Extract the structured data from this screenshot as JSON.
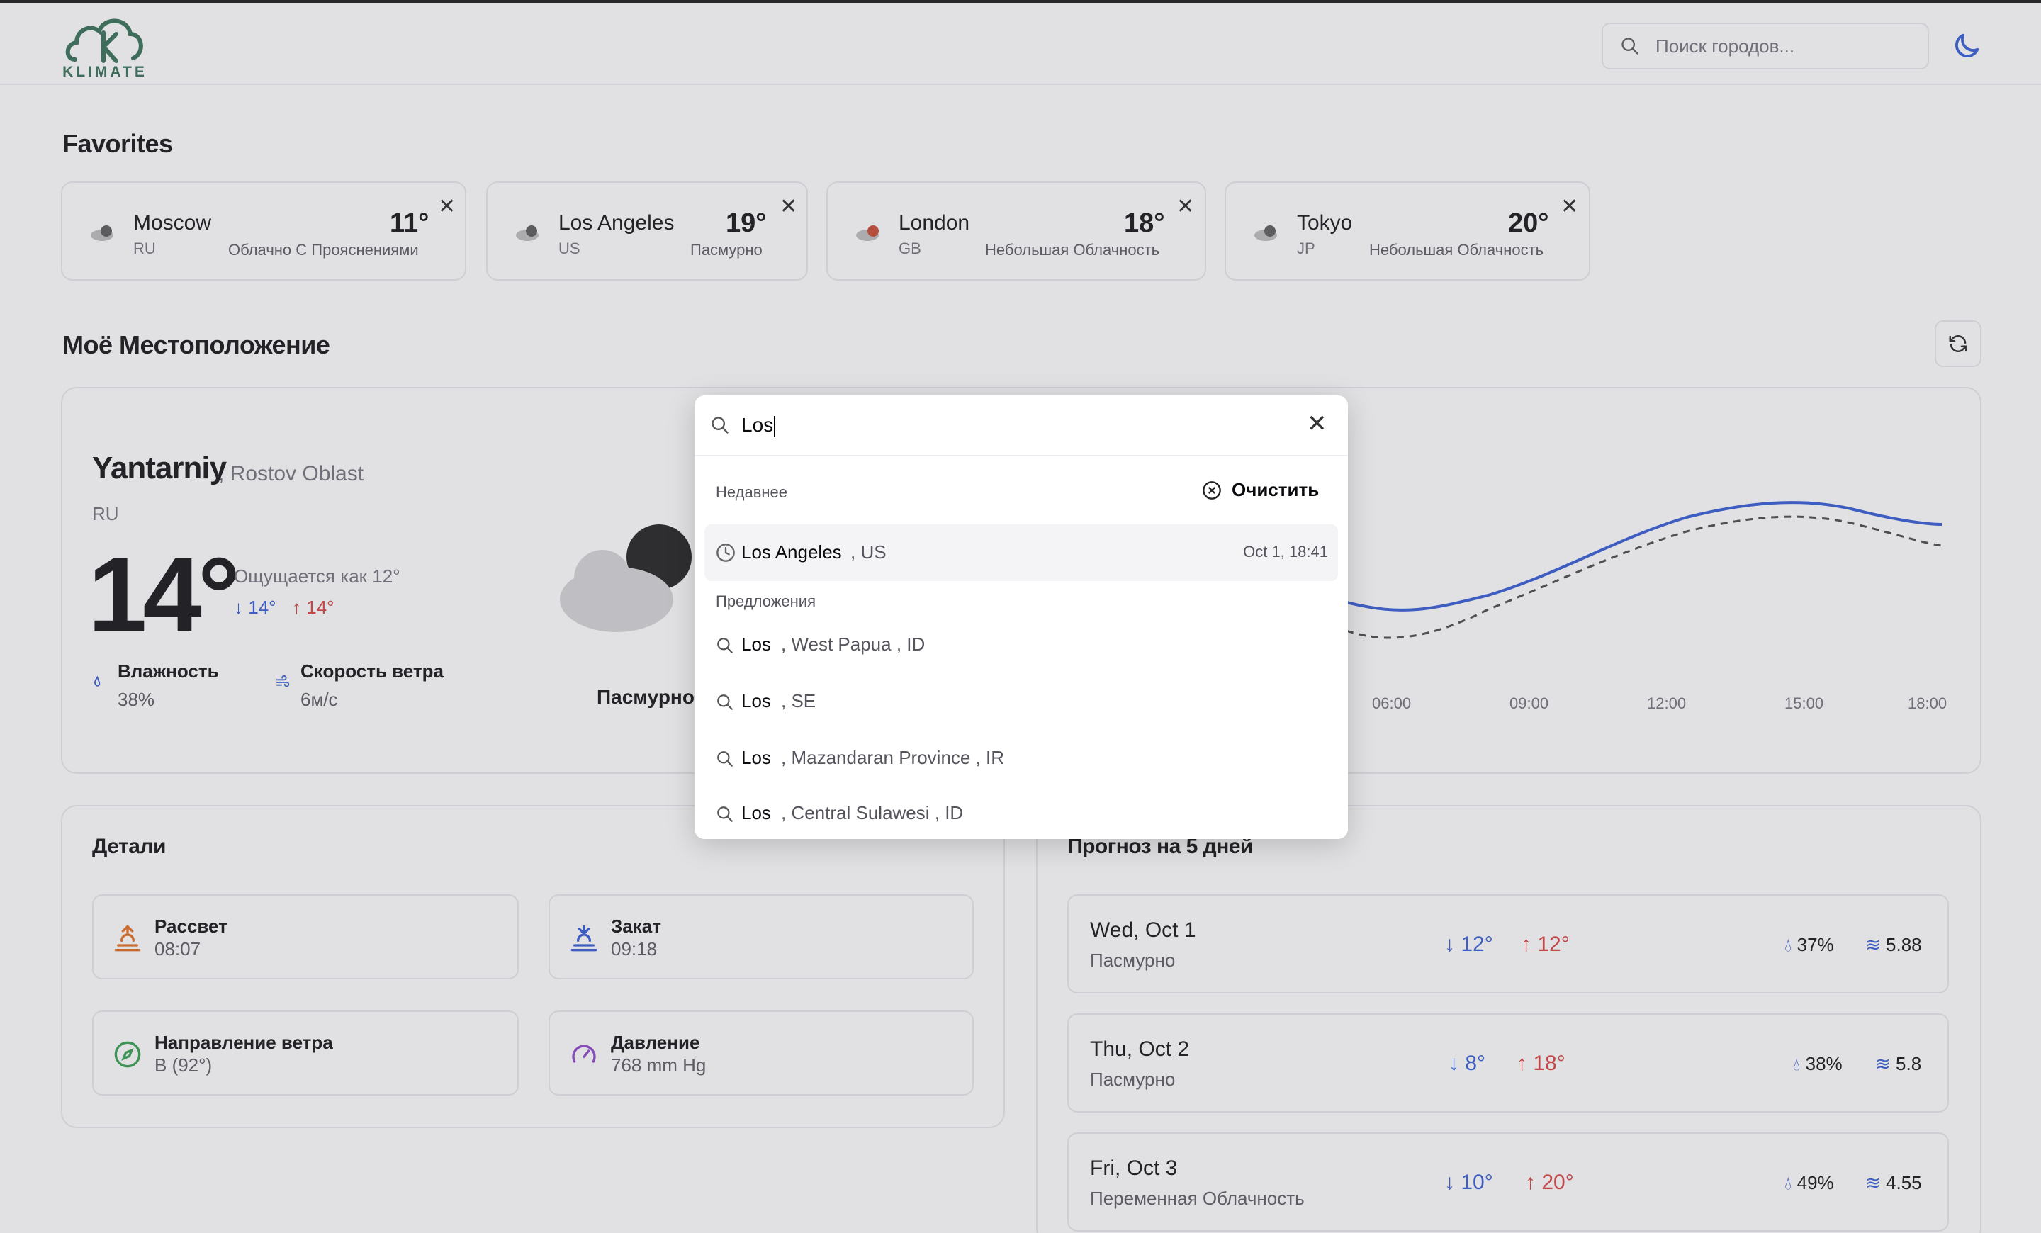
{
  "header": {
    "logo_text": "KLIMATE",
    "search_placeholder": "Поиск городов..."
  },
  "favorites": {
    "title": "Favorites",
    "items": [
      {
        "city": "Moscow",
        "country": "RU",
        "temp": "11°",
        "desc": "Облачно С Прояснениями"
      },
      {
        "city": "Los Angeles",
        "country": "US",
        "temp": "19°",
        "desc": "Пасмурно"
      },
      {
        "city": "London",
        "country": "GB",
        "temp": "18°",
        "desc": "Небольшая Облачность"
      },
      {
        "city": "Tokyo",
        "country": "JP",
        "temp": "20°",
        "desc": "Небольшая Облачность"
      }
    ]
  },
  "location": {
    "title": "Моё Местоположение",
    "city": "Yantarniy",
    "region": ", Rostov Oblast",
    "country": "RU",
    "temp": "14°",
    "feels_like": "Ощущается как 12°",
    "min": "14°",
    "max": "14°",
    "humidity_label": "Влажность",
    "humidity_value": "38%",
    "wind_label": "Скорость ветра",
    "wind_value": "6м/с",
    "condition": "Пасмурно",
    "hours": [
      "06:00",
      "09:00",
      "12:00",
      "15:00",
      "18:00"
    ]
  },
  "details": {
    "title": "Детали",
    "sunrise_label": "Рассвет",
    "sunrise_value": "08:07",
    "sunset_label": "Закат",
    "sunset_value": "09:18",
    "wind_dir_label": "Направление ветра",
    "wind_dir_value": "В (92°)",
    "pressure_label": "Давление",
    "pressure_value": "768 mm Hg"
  },
  "forecast": {
    "title": "Прогноз на 5 дней",
    "days": [
      {
        "day": "Wed, Oct 1",
        "desc": "Пасмурно",
        "min": "12°",
        "max": "12°",
        "humidity": "37%",
        "wind": "5.88"
      },
      {
        "day": "Thu, Oct 2",
        "desc": "Пасмурно",
        "min": "8°",
        "max": "18°",
        "humidity": "38%",
        "wind": "5.8"
      },
      {
        "day": "Fri, Oct 3",
        "desc": "Переменная Облачность",
        "min": "10°",
        "max": "20°",
        "humidity": "49%",
        "wind": "4.55"
      }
    ]
  },
  "search_modal": {
    "query": "Los",
    "recent_heading": "Недавнее",
    "clear_label": "Очистить",
    "recent": [
      {
        "name": "Los Angeles",
        "country": ", US",
        "time": "Oct 1, 18:41"
      }
    ],
    "suggestions_heading": "Предложения",
    "suggestions": [
      {
        "name": "Los",
        "place": ", West Papua   , ID"
      },
      {
        "name": "Los",
        "place": ", SE"
      },
      {
        "name": "Los",
        "place": ", Mazandaran Province   , IR"
      },
      {
        "name": "Los",
        "place": ", Central Sulawesi   , ID"
      }
    ]
  },
  "colors": {
    "accent_blue": "#2f57d4",
    "hot_red": "#d63a3a",
    "brand_green": "#2f6b52"
  }
}
